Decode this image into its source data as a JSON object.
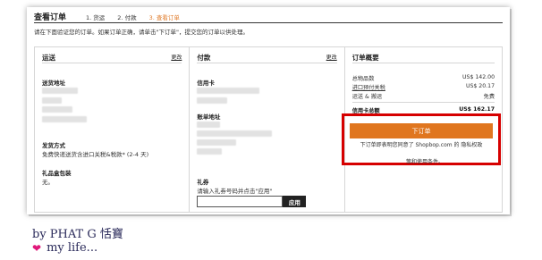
{
  "header": {
    "title": "查看订单",
    "steps": [
      "1. 货运",
      "2. 付款",
      "3. 查看订单"
    ]
  },
  "notice": "请在下面验证您的订单。如果订单正确，请单击\"下订单\"，提交您的订单以供处理。",
  "shipping": {
    "title": "运送",
    "edit": "更改",
    "address_label": "送货地址",
    "method_label": "发货方式",
    "method_value": "免费快递送货含进口关税&税款* (2-4 天)",
    "gift_label": "礼品盒包装",
    "gift_value": "无。"
  },
  "payment": {
    "title": "付款",
    "edit": "更改",
    "card_label": "信用卡",
    "billing_label": "账单地址",
    "coupon_label": "礼券",
    "coupon_hint": "请输入礼券号码并点击\"应用\"",
    "apply": "应用"
  },
  "summary": {
    "title": "订单概要",
    "rows": [
      {
        "label": "总物品数",
        "value": "US$ 142.00"
      },
      {
        "label": "进口预付关税",
        "value": "US$ 20.17"
      },
      {
        "label": "运送 & 搬运",
        "value": "免费"
      }
    ],
    "total_label": "信用卡总额",
    "total_value": "US$ 162.17",
    "order_button": "下订单",
    "terms_line1": "下订单即表明您同意了 Shopbop.com 的 隐私权政",
    "terms_line2": "策和使用条件。"
  },
  "signature": {
    "line1": "by PHAT G 恬寶",
    "line2": "my life..."
  },
  "colors": {
    "accent": "#e07b2a",
    "highlight": "#d60000",
    "button": "#e0761f"
  }
}
